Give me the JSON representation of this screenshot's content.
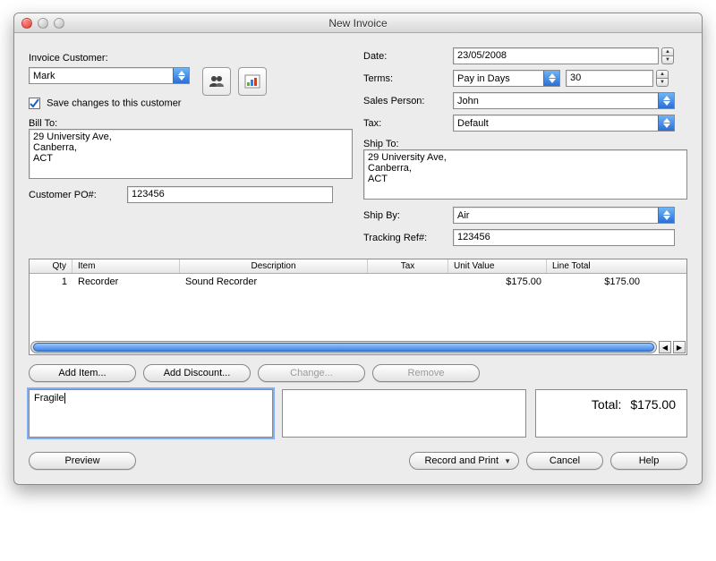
{
  "window": {
    "title": "New Invoice"
  },
  "left": {
    "customer_label": "Invoice Customer:",
    "customer_value": "Mark",
    "save_changes_label": "Save changes to this customer",
    "bill_to_label": "Bill To:",
    "bill_to_value": "29 University Ave,\nCanberra,\nACT",
    "po_label": "Customer PO#:",
    "po_value": "123456"
  },
  "right": {
    "date_label": "Date:",
    "date_value": "23/05/2008",
    "terms_label": "Terms:",
    "terms_value": "Pay in Days",
    "terms_days": "30",
    "sales_label": "Sales Person:",
    "sales_value": "John",
    "tax_label": "Tax:",
    "tax_value": "Default",
    "ship_to_label": "Ship To:",
    "ship_to_value": "29 University Ave,\nCanberra,\nACT",
    "ship_by_label": "Ship By:",
    "ship_by_value": "Air",
    "tracking_label": "Tracking Ref#:",
    "tracking_value": "123456"
  },
  "table": {
    "headers": {
      "qty": "Qty",
      "item": "Item",
      "desc": "Description",
      "tax": "Tax",
      "uval": "Unit Value",
      "total": "Line Total"
    },
    "rows": [
      {
        "qty": "1",
        "item": "Recorder",
        "desc": "Sound Recorder",
        "tax": "",
        "uval": "$175.00",
        "total": "$175.00"
      }
    ]
  },
  "buttons": {
    "add_item": "Add Item...",
    "add_discount": "Add Discount...",
    "change": "Change...",
    "remove": "Remove",
    "preview": "Preview",
    "record_print": "Record and Print",
    "cancel": "Cancel",
    "help": "Help"
  },
  "notes": {
    "comment": "Fragile"
  },
  "total": {
    "label": "Total:",
    "value": "$175.00"
  }
}
